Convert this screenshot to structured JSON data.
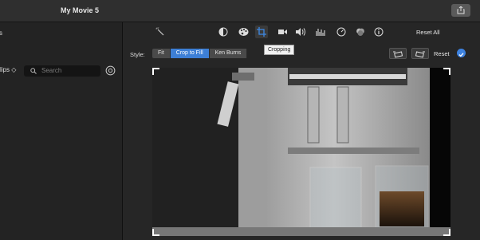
{
  "window": {
    "title": "My Movie 5"
  },
  "left": {
    "library_label": "s",
    "clips_label": "lips ◇",
    "search": {
      "placeholder": "Search",
      "value": ""
    }
  },
  "toolbar": {
    "icons": [
      "magic-wand-icon",
      "color-balance-icon",
      "palette-icon",
      "crop-icon",
      "camera-icon",
      "volume-icon",
      "equalizer-icon",
      "speed-icon",
      "filter-icon",
      "info-icon"
    ],
    "reset_all": "Reset All",
    "tooltip": "Cropping"
  },
  "crop": {
    "style_label": "Style:",
    "options": [
      "Fit",
      "Crop to Fill",
      "Ken Burns"
    ],
    "selected": "Crop to Fill",
    "reset_label": "Reset"
  },
  "colors": {
    "accent": "#3d7fd6",
    "background": "#1e1e1e"
  }
}
